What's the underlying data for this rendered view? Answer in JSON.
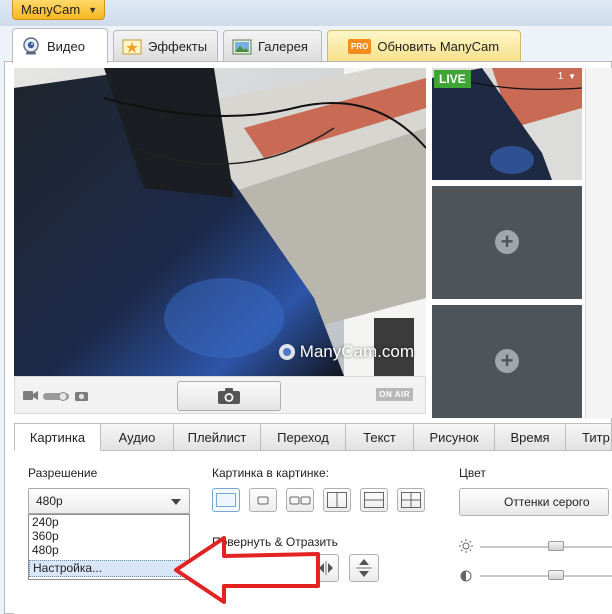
{
  "app": {
    "menu_label": "ManyCam"
  },
  "main_tabs": [
    {
      "label": "Видео",
      "icon": "camera-icon",
      "active": true
    },
    {
      "label": "Эффекты",
      "icon": "effects-icon",
      "active": false
    },
    {
      "label": "Галерея",
      "icon": "gallery-icon",
      "active": false
    },
    {
      "label": "Обновить ManyCam",
      "icon": "pro-badge-icon",
      "badge": "PRO",
      "active": false
    }
  ],
  "preview": {
    "watermark": "ManyCam.com",
    "onair_label": "ON AIR"
  },
  "sources": {
    "live_label": "LIVE",
    "slot_number": "1"
  },
  "bottom_tabs": [
    {
      "label": "Картинка",
      "active": true
    },
    {
      "label": "Аудио"
    },
    {
      "label": "Плейлист"
    },
    {
      "label": "Переход"
    },
    {
      "label": "Текст"
    },
    {
      "label": "Рисунок"
    },
    {
      "label": "Время"
    },
    {
      "label": "Титр"
    }
  ],
  "picture_panel": {
    "resolution_label": "Разрешение",
    "resolution_value": "480p",
    "resolution_options": [
      "240p",
      "360p",
      "480p",
      "Настройка..."
    ],
    "highlighted_option": "Настройка...",
    "pip_label": "Картинка в картинке:",
    "rotate_label": "Повернуть & Отразить",
    "color_label": "Цвет",
    "grayscale_button": "Оттенки серого",
    "brightness_level": 0.62,
    "contrast_level": 0.62
  },
  "colors": {
    "live_green": "#3fa535",
    "annotation_red": "#e32222",
    "slot_gray": "#4e555a",
    "menu_orange": "#f6b820"
  }
}
